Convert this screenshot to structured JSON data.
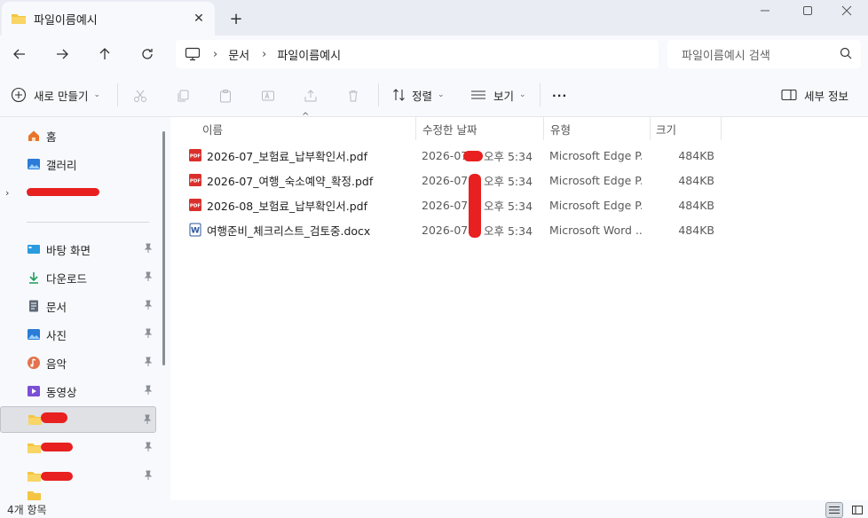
{
  "window": {
    "tab_title": "파일이름예시",
    "new_tab_label": "+"
  },
  "address": {
    "crumbs": [
      "문서",
      "파일이름예시"
    ],
    "search_placeholder": "파일이름예시 검색"
  },
  "commands": {
    "new_label": "새로 만들기",
    "sort_label": "정렬",
    "view_label": "보기",
    "more_label": "···",
    "details_label": "세부 정보"
  },
  "sidebar": {
    "home": "홈",
    "gallery": "갤러리",
    "pinned": [
      {
        "label": "바탕 화면",
        "icon": "desktop-icon"
      },
      {
        "label": "다운로드",
        "icon": "download-icon"
      },
      {
        "label": "문서",
        "icon": "documents-icon"
      },
      {
        "label": "사진",
        "icon": "pictures-icon"
      },
      {
        "label": "음악",
        "icon": "music-icon"
      },
      {
        "label": "동영상",
        "icon": "videos-icon"
      }
    ]
  },
  "columns": {
    "name": "이름",
    "modified": "수정한 날짜",
    "type": "유형",
    "size": "크기"
  },
  "files": [
    {
      "name": "2026-07_보험료_납부확인서.pdf",
      "date_prefix": "2026-07",
      "time": "오후 5:34",
      "type": "Microsoft Edge P...",
      "size": "484KB",
      "kind": "pdf"
    },
    {
      "name": "2026-07_여행_숙소예약_확정.pdf",
      "date_prefix": "2026-07",
      "time": "오후 5:34",
      "type": "Microsoft Edge P...",
      "size": "484KB",
      "kind": "pdf"
    },
    {
      "name": "2026-08_보험료_납부확인서.pdf",
      "date_prefix": "2026-07",
      "time": "오후 5:34",
      "type": "Microsoft Edge P...",
      "size": "484KB",
      "kind": "pdf"
    },
    {
      "name": "여행준비_체크리스트_검토중.docx",
      "date_prefix": "2026-07",
      "time": "오후 5:34",
      "type": "Microsoft Word ...",
      "size": "484KB",
      "kind": "docx"
    }
  ],
  "status": {
    "item_count": "4개 항목"
  },
  "colors": {
    "accent": "#0067c0",
    "folder": "#f4c542",
    "pdf": "#d9302c",
    "word": "#2b579a",
    "redaction": "#e82020"
  }
}
